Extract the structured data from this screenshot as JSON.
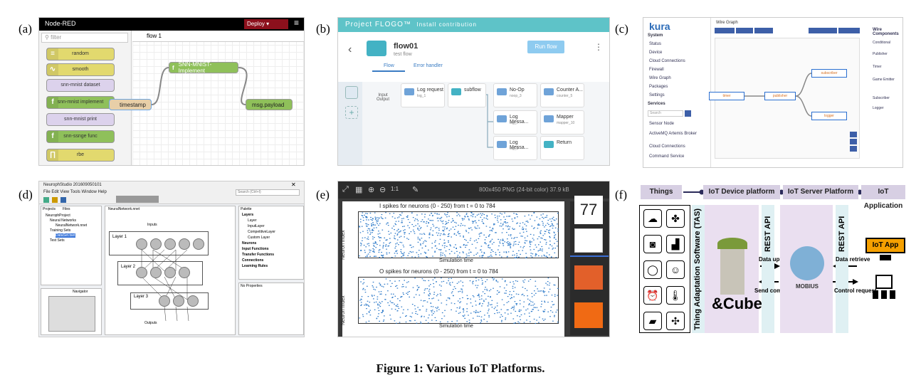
{
  "caption": "Figure 1: Various IoT Platforms.",
  "labels": {
    "a": "(a)",
    "b": "(b)",
    "c": "(c)",
    "d": "(d)",
    "e": "(e)",
    "f": "(f)"
  },
  "nodered": {
    "logo": "Node-RED",
    "deploy": "Deploy",
    "filter_placeholder": "filter",
    "tab": "flow 1",
    "palette": [
      "random",
      "smooth",
      "snn-mnist dataset",
      "snn-mnist implement",
      "snn-mnist print",
      "snn-ssnge func",
      "rbe"
    ],
    "nodes": {
      "timestamp": "timestamp",
      "snn": "SNN-MNIST-Implement",
      "payload": "msg.payload"
    }
  },
  "flogo": {
    "header": "Project FLOGO™",
    "install": "Install contribution",
    "flow_title": "flow01",
    "flow_sub": "test flow",
    "run": "Run flow",
    "tab_flow": "Flow",
    "tab_error": "Error handler",
    "io_label": "Input Output",
    "cards": [
      {
        "t": "Log request",
        "s": "log_1"
      },
      {
        "t": "subflow",
        "s": ""
      },
      {
        "t": "No-Op",
        "s": "noop_3"
      },
      {
        "t": "Counter A...",
        "s": "counter_5"
      },
      {
        "t": "Log Messa...",
        "s": "log_7"
      },
      {
        "t": "Mapper",
        "s": "mapper_10"
      },
      {
        "t": "Log Messa...",
        "s": "log_8"
      },
      {
        "t": "Return",
        "s": ""
      }
    ]
  },
  "kura": {
    "logo": "kura",
    "system": "System",
    "items": [
      "Status",
      "Device",
      "Cloud Connections",
      "Firewall",
      "Wire Graph",
      "Packages",
      "Settings"
    ],
    "services": "Services",
    "search": "Search",
    "service_items": [
      "Sensor Node",
      "ActiveMQ Artemis Broker",
      "Cloud Connections",
      "Command Service"
    ],
    "wire_title": "Wire Graph",
    "boxes": {
      "timer": "timer",
      "publisher": "publisher",
      "subscriber": "subscriber",
      "logger": "logger"
    },
    "right_title": "Wire Components",
    "right_items": [
      "Conditional",
      "Publisher",
      "Timer",
      "Game Emitter",
      "Subscriber",
      "Logger"
    ]
  },
  "neuroph": {
    "title": "NeurophStudio 201609050101",
    "menu": "File  Edit  View  Tools  Window  Help",
    "search": "Search (Ctrl+I)",
    "tabs": {
      "projects": "Projects",
      "files": "Files",
      "nn": "NeuralNetwork.nnet",
      "palette": "Palette"
    },
    "tree": [
      "NeurophProject",
      "Neural Networks",
      "NeuralNetwork.nnet",
      "Training Sets",
      "DataSet.tset",
      "Test Sets"
    ],
    "layers": [
      "Layer 1",
      "Layer 2",
      "Layer 3"
    ],
    "inputs": "Inputs",
    "outputs": "Outputs",
    "palette_items": [
      "Layers",
      "Layer",
      "InputLayer",
      "CompetitiveLayer",
      "Custom Layer",
      "Neurons",
      "Input Functions",
      "Transfer Functions",
      "Connections",
      "Learning Rules"
    ],
    "props": "No Properties",
    "nav": "Navigator"
  },
  "spikes": {
    "info": "800x450 PNG (24-bit color) 37.9 kB",
    "plot1_title": "I spikes for neurons (0 - 250) from t = 0 to 784",
    "plot2_title": "O spikes for neurons (0 - 250) from t = 0 to 784",
    "ylabel": "Neuron index",
    "xlabel": "Simulation time",
    "thumb": "77"
  },
  "arch": {
    "things": "Things",
    "device": "IoT Device platform",
    "server": "IoT Server Platform",
    "app": "IoT Application",
    "tas": "Thing Adaptation Software (TAS)",
    "rest1": "REST API",
    "rest2": "REST API",
    "cube": "&Cube",
    "mobius": "MOBIUS",
    "upload": "Data upload",
    "send": "Send command",
    "retrieve": "Data retrieve",
    "control": "Control request",
    "iotapp": "IoT App"
  }
}
